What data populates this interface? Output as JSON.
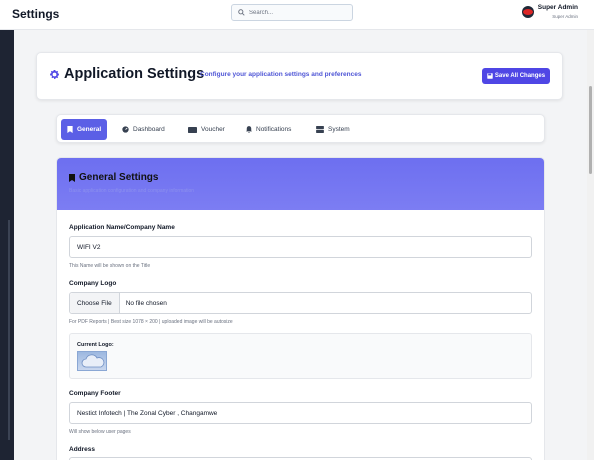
{
  "topbar": {
    "brand": "Settings",
    "search_placeholder": "Search...",
    "user_name": "Super Admin",
    "user_role": "Super Admin"
  },
  "header": {
    "title": "Application Settings",
    "subtitle": "Configure your application settings and preferences",
    "save_label": "Save All Changes",
    "accent": "#4f46e5"
  },
  "tabs": [
    {
      "label": "General",
      "icon": "bookmark-icon",
      "active": true
    },
    {
      "label": "Dashboard",
      "icon": "dashboard-icon",
      "active": false
    },
    {
      "label": "Voucher",
      "icon": "ticket-icon",
      "active": false
    },
    {
      "label": "Notifications",
      "icon": "bell-icon",
      "active": false
    },
    {
      "label": "System",
      "icon": "server-icon",
      "active": false
    }
  ],
  "general": {
    "title": "General Settings",
    "subtitle": "Basic application configuration and company information",
    "app_name_label": "Application Name/Company Name",
    "app_name_value": "WIFI V2",
    "app_name_hint": "This Name will be shown on the Title",
    "logo_label": "Company Logo",
    "file_button": "Choose File",
    "file_status": "No file chosen",
    "logo_hint": "For PDF Reports | Best size 1078 × 200 | uploaded image will be autosize",
    "current_logo_label": "Current Logo:",
    "footer_label": "Company Footer",
    "footer_value": "Nestict Infotech | The Zonal Cyber , Changamwe",
    "footer_hint": "Will show below user pages",
    "address_label": "Address"
  }
}
